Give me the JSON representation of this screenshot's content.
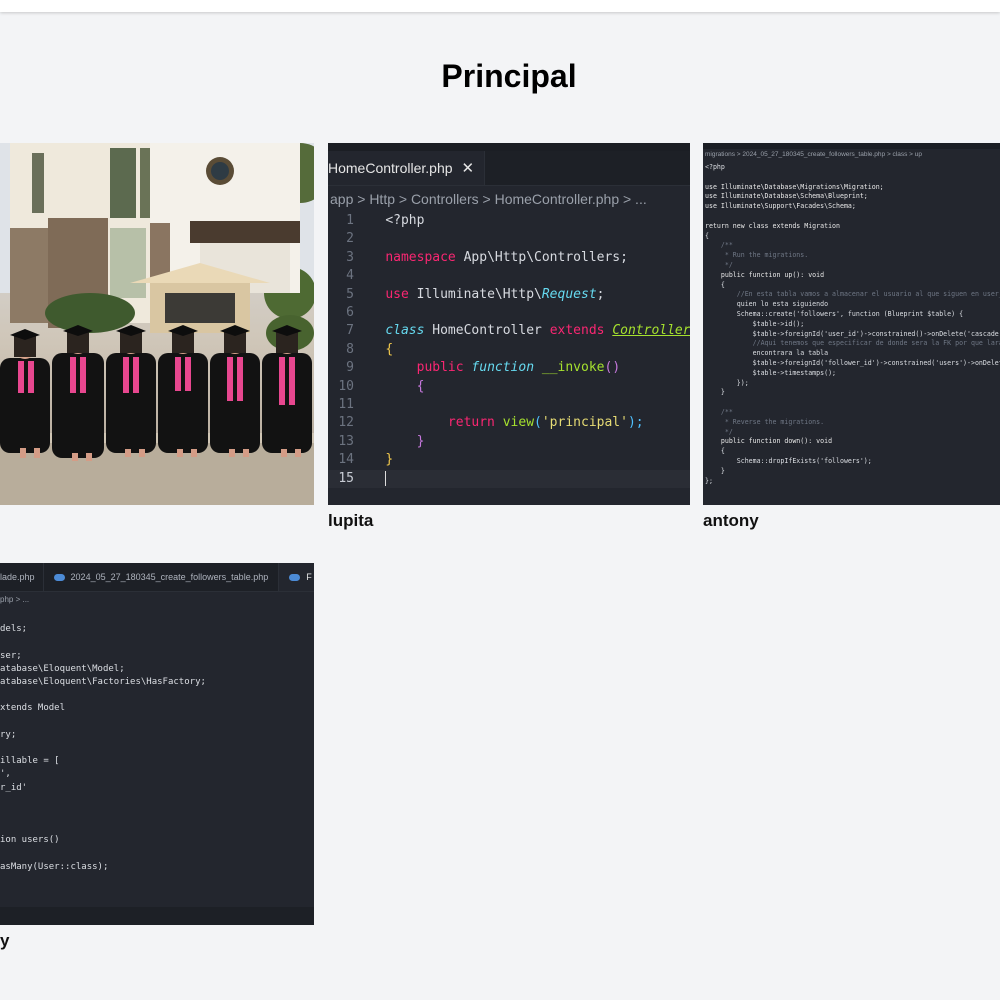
{
  "page": {
    "title": "Principal"
  },
  "cards": [
    {
      "caption": "",
      "kind": "photo"
    },
    {
      "caption": "lupita",
      "tab": "HomeController.php",
      "breadcrumb": "app > Http > Controllers > HomeController.php > ...",
      "lines": [
        {
          "n": "1"
        },
        {
          "n": "2"
        },
        {
          "n": "3"
        },
        {
          "n": "4"
        },
        {
          "n": "5"
        },
        {
          "n": "6"
        },
        {
          "n": "7"
        },
        {
          "n": "8"
        },
        {
          "n": "9"
        },
        {
          "n": "10"
        },
        {
          "n": "11"
        },
        {
          "n": "12"
        },
        {
          "n": "13"
        },
        {
          "n": "14"
        },
        {
          "n": "15"
        }
      ],
      "code": {
        "l1": "<?php",
        "l3a": "namespace",
        "l3b": " App\\Http\\Controllers;",
        "l5a": "use",
        "l5b": " Illuminate\\Http\\",
        "l5c": "Request",
        "l5d": ";",
        "l7a": "class",
        "l7b": " HomeController ",
        "l7c": "extends",
        "l7d": " ",
        "l7e": "Controller",
        "l8": "{",
        "l9a": "public",
        "l9b": " function",
        "l9c": " __invoke",
        "l9d": "()",
        "l10": "{",
        "l12a": "return",
        "l12b": " view",
        "l12c": "(",
        "l12d": "'principal'",
        "l12e": ");",
        "l13": "}",
        "l14": "}"
      }
    },
    {
      "caption": "antony",
      "breadcrumb": "migrations > 2024_05_27_180345_create_followers_table.php > class > up",
      "code": [
        "<?php",
        "",
        "use Illuminate\\Database\\Migrations\\Migration;",
        "use Illuminate\\Database\\Schema\\Blueprint;",
        "use Illuminate\\Support\\Facades\\Schema;",
        "",
        "return new class extends Migration",
        "{",
        "    /**",
        "     * Run the migrations.",
        "     */",
        "    public function up(): void",
        "    {",
        "        //En esta tabla vamos a almacenar el usuario al que siguen en user_id y",
        "        quien lo esta siguiendo",
        "        Schema::create('followers', function (Blueprint $table) {",
        "            $table->id();",
        "            $table->foreignId('user_id')->constrained()->onDelete('cascade');",
        "            //Aqui tenemos que especificar de donde sera la FK por que laravel no lo",
        "            encontrara la tabla",
        "            $table->foreignId('follower_id')->constrained('users')->onDelete('cascade');",
        "            $table->timestamps();",
        "        });",
        "    }",
        "",
        "    /**",
        "     * Reverse the migrations.",
        "     */",
        "    public function down(): void",
        "    {",
        "        Schema::dropIfExists('followers');",
        "    }",
        "};"
      ]
    },
    {
      "caption": "y",
      "tabs": [
        "lade.php",
        "2024_05_27_180345_create_followers_table.php",
        "F"
      ],
      "breadcrumb": "php > ...",
      "code": [
        "",
        "dels;",
        "",
        "ser;",
        "atabase\\Eloquent\\Model;",
        "atabase\\Eloquent\\Factories\\HasFactory;",
        "",
        "xtends Model",
        "",
        "ry;",
        "",
        "illable = [",
        "',",
        "r_id'",
        "",
        "",
        "",
        "ion users()",
        "",
        "asMany(User::class);",
        ""
      ]
    }
  ]
}
